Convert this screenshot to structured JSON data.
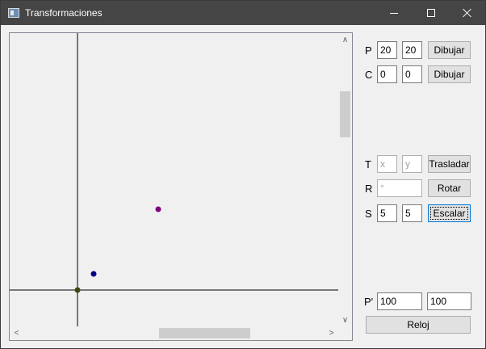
{
  "window": {
    "title": "Transformaciones"
  },
  "controls": {
    "p": {
      "label": "P",
      "x": "20",
      "y": "20",
      "button": "Dibujar"
    },
    "c": {
      "label": "C",
      "x": "0",
      "y": "0",
      "button": "Dibujar"
    },
    "t": {
      "label": "T",
      "x_placeholder": "x",
      "y_placeholder": "y",
      "button": "Trasladar"
    },
    "r": {
      "label": "R",
      "placeholder": "°",
      "button": "Rotar"
    },
    "s": {
      "label": "S",
      "x": "5",
      "y": "5",
      "button": "Escalar"
    },
    "p_prime": {
      "label": "P'",
      "x": "100",
      "y": "100"
    },
    "clock_button": "Reloj"
  },
  "plot": {
    "axis_color": "#000000",
    "points": [
      {
        "name": "origin-point",
        "color": "#3a4a10"
      },
      {
        "name": "point-c",
        "color": "#000080"
      },
      {
        "name": "point-p",
        "color": "#800080"
      }
    ]
  }
}
